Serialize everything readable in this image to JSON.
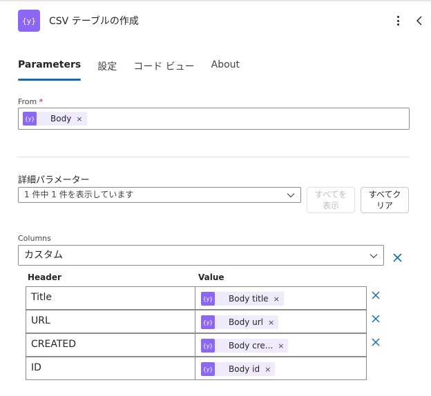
{
  "header": {
    "title": "CSV テーブルの作成",
    "icon": "table-braces-icon",
    "accent": "#8c67f6"
  },
  "tabs": [
    {
      "label": "Parameters",
      "active": true
    },
    {
      "label": "設定",
      "active": false
    },
    {
      "label": "コード ビュー",
      "active": false
    },
    {
      "label": "About",
      "active": false
    }
  ],
  "from": {
    "label": "From",
    "required_mark": "*",
    "token": {
      "label": "Body",
      "remove": "×"
    }
  },
  "advanced": {
    "label": "詳細パラメーター",
    "select_value": "1 件中 1 件を表示しています",
    "show_all_lines": [
      "すべてを",
      "表示"
    ],
    "clear_all_lines": [
      "すべてク",
      "リア"
    ]
  },
  "columns": {
    "label": "Columns",
    "select_value": "カスタム",
    "header_col": "Header",
    "value_col": "Value",
    "rows": [
      {
        "header": "Title",
        "token": "Body title",
        "remove": "×",
        "deletable": true
      },
      {
        "header": "URL",
        "token": "Body url",
        "remove": "×",
        "deletable": true
      },
      {
        "header": "CREATED",
        "token": "Body cre...",
        "remove": "×",
        "deletable": true
      },
      {
        "header": "ID",
        "token": "Body id",
        "remove": "×",
        "deletable": false
      }
    ]
  },
  "colors": {
    "accent_purple": "#8c67f6",
    "token_bg": "#efeafc",
    "tab_underline": "#0f6cbd",
    "delete_blue": "#0f6cbd",
    "required_red": "#c50f1f"
  }
}
